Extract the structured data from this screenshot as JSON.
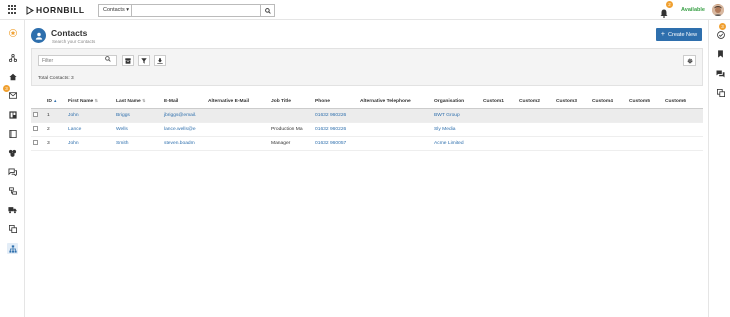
{
  "topbar": {
    "logo_text": "HORNBILL",
    "search_scope": "Contacts",
    "search_placeholder": "",
    "notifications_count": "2",
    "status": "Available"
  },
  "leftnav": {
    "mail_badge": "3",
    "items": [
      "star-icon",
      "workflow-icon",
      "home-icon",
      "mail-icon",
      "board-icon",
      "book-icon",
      "team-icon",
      "chat-icon",
      "service-icon",
      "truck-icon",
      "docs-icon",
      "org-icon"
    ]
  },
  "rightnav": {
    "tasks_badge": "3",
    "items": [
      "tasks-icon",
      "bookmark-icon",
      "comments-icon",
      "docs-icon"
    ]
  },
  "page": {
    "title": "Contacts",
    "subtitle": "Search your Contacts",
    "create_label": "Create New"
  },
  "toolbar": {
    "filter_placeholder": "Filter",
    "total": "Total Contacts: 3"
  },
  "table": {
    "columns": [
      "ID",
      "First Name",
      "Last Name",
      "E-Mail",
      "Alternative E-Mail",
      "Job Title",
      "Phone",
      "Alternative Telephone",
      "Organisation",
      "Custom1",
      "Custom2",
      "Custom3",
      "Custom4",
      "Custom5",
      "Custom6"
    ],
    "rows": [
      {
        "id": "1",
        "first": "John",
        "last": "Briggs",
        "email": "jbriggs@email.",
        "alt_email": "",
        "job": "",
        "phone": "01632 960226",
        "alt_phone": "",
        "org": "BWT Group"
      },
      {
        "id": "2",
        "first": "Lance",
        "last": "Wells",
        "email": "lance.wells@e",
        "alt_email": "",
        "job": "Production Ma",
        "phone": "01632 960226",
        "alt_phone": "",
        "org": "Sly Media"
      },
      {
        "id": "3",
        "first": "John",
        "last": "Smith",
        "email": "steven.boadm",
        "alt_email": "",
        "job": "Manager",
        "phone": "01632 960057",
        "alt_phone": "",
        "org": "Acme Limited"
      }
    ]
  },
  "colors": {
    "accent": "#2e6fad",
    "status": "#3aa047",
    "badge": "#f0a030"
  }
}
